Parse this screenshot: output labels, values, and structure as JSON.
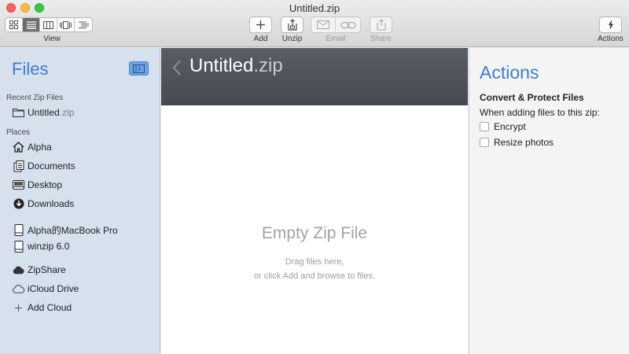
{
  "window": {
    "title": "Untitled.zip"
  },
  "toolbar": {
    "view_label": "View",
    "add_label": "Add",
    "unzip_label": "Unzip",
    "email_label": "Email",
    "share_label": "Share",
    "actions_label": "Actions"
  },
  "sidebar": {
    "title": "Files",
    "recent_header": "Recent Zip Files",
    "recent_item": {
      "name": "Untitled",
      "ext": ".zip"
    },
    "places_header": "Places",
    "places": [
      {
        "label": "Alpha",
        "icon": "home-icon"
      },
      {
        "label": "Documents",
        "icon": "documents-icon"
      },
      {
        "label": "Desktop",
        "icon": "desktop-icon"
      },
      {
        "label": "Downloads",
        "icon": "downloads-icon"
      },
      {
        "label": "Alpha的MacBook Pro",
        "icon": "drive-icon"
      },
      {
        "label": "winzip 6.0",
        "icon": "drive-icon"
      },
      {
        "label": "ZipShare",
        "icon": "cloud-filled-icon"
      },
      {
        "label": "iCloud Drive",
        "icon": "cloud-outline-icon"
      },
      {
        "label": "Add Cloud",
        "icon": "plus-icon"
      }
    ]
  },
  "center": {
    "title_name": "Untitled",
    "title_ext": ".zip",
    "empty_title": "Empty Zip File",
    "empty_hint_1": "Drag files here,",
    "empty_hint_2": "or click Add and browse to files."
  },
  "actions_panel": {
    "title": "Actions",
    "subtitle": "Convert & Protect Files",
    "description": "When adding files to this zip:",
    "options": [
      {
        "label": "Encrypt",
        "checked": false
      },
      {
        "label": "Resize photos",
        "checked": false
      }
    ]
  },
  "colors": {
    "accent": "#3a7ed4",
    "sidebar_bg": "#d7e0ed",
    "header_bg": "#4f525a"
  }
}
